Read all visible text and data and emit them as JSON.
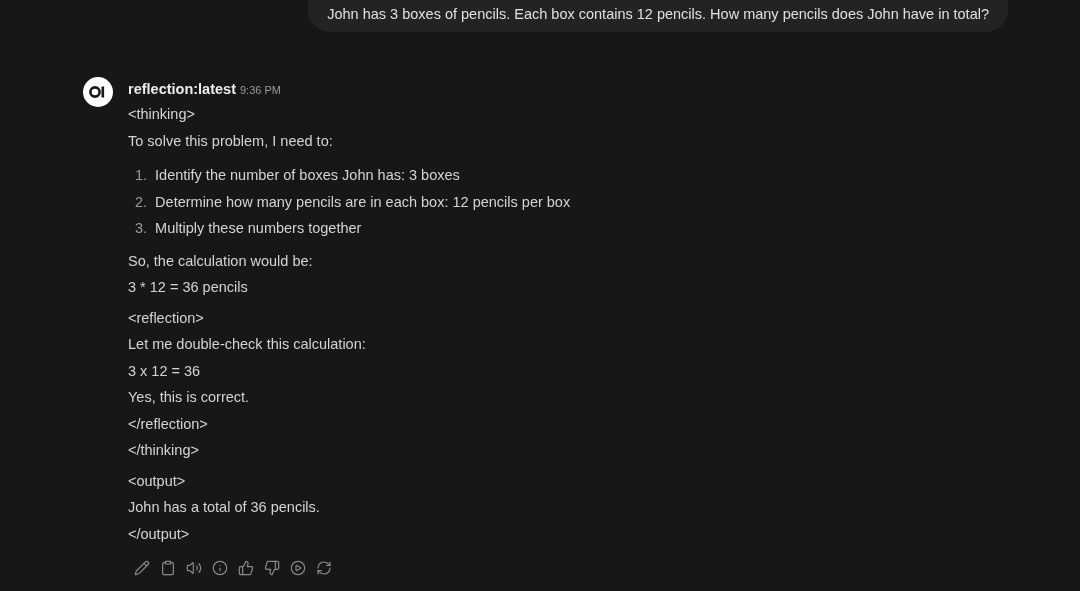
{
  "user_message": "John has 3 boxes of pencils. Each box contains 12 pencils. How many pencils does John have in total?",
  "assistant": {
    "name": "reflection:latest",
    "time": "9:36 PM",
    "blocks": [
      {
        "kind": "lines",
        "lines": [
          "<thinking>",
          "To solve this problem, I need to:"
        ]
      },
      {
        "kind": "list",
        "items": [
          {
            "number": "1.",
            "text": "Identify the number of boxes John has: 3 boxes"
          },
          {
            "number": "2.",
            "text": "Determine how many pencils are in each box: 12 pencils per box"
          },
          {
            "number": "3.",
            "text": "Multiply these numbers together"
          }
        ]
      },
      {
        "kind": "lines",
        "lines": [
          "So, the calculation would be:",
          "3 * 12 = 36 pencils"
        ]
      },
      {
        "kind": "lines",
        "lines": [
          "<reflection>",
          "Let me double-check this calculation:",
          "3 x 12 = 36",
          "Yes, this is correct.",
          "</reflection>",
          "</thinking>"
        ]
      },
      {
        "kind": "lines",
        "lines": [
          "<output>",
          "John has a total of 36 pencils.",
          "</output>"
        ]
      }
    ]
  }
}
